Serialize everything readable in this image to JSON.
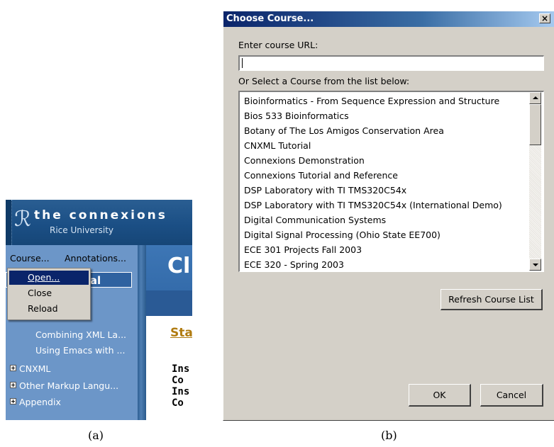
{
  "panel_a": {
    "brand": {
      "title": "the connexions",
      "subtitle": "Rice University"
    },
    "menubar": {
      "course_menu": "Course...",
      "annotations_menu": "Annotations..."
    },
    "course_popup": {
      "items": [
        "Open...",
        "Close",
        "Reload"
      ]
    },
    "tutorial_tab_fragment": "orial",
    "sidebar_items": [
      {
        "label": "Combining XML La..."
      },
      {
        "label": "Using Emacs with ..."
      },
      {
        "label": "CNXML"
      },
      {
        "label": "Other Markup Langu..."
      },
      {
        "label": "Appendix"
      }
    ],
    "content": {
      "heading_fragment": "Cl",
      "link_fragment": "Sta",
      "bold_lines": [
        "Ins",
        "Co",
        "Ins",
        "Co"
      ]
    },
    "caption": "(a)"
  },
  "panel_b": {
    "dialog_title": "Choose Course...",
    "close_glyph": "×",
    "url_label": "Enter course URL:",
    "url_value": "",
    "list_label": "Or Select a Course from the list below:",
    "courses": [
      "Bioinformatics - From Sequence Expression and Structure",
      "Bios 533 Bioinformatics",
      "Botany of The Los Amigos Conservation Area",
      "CNXML Tutorial",
      "Connexions Demonstration",
      "Connexions Tutorial and Reference",
      "DSP Laboratory with TI TMS320C54x",
      "DSP Laboratory with TI TMS320C54x (International Demo)",
      "Digital Communication Systems",
      "Digital Signal Processing (Ohio State EE700)",
      "ECE 301 Projects Fall 2003",
      "ECE 320 - Spring 2003"
    ],
    "refresh_button": "Refresh Course List",
    "ok_button": "OK",
    "cancel_button": "Cancel",
    "caption": "(b)"
  }
}
